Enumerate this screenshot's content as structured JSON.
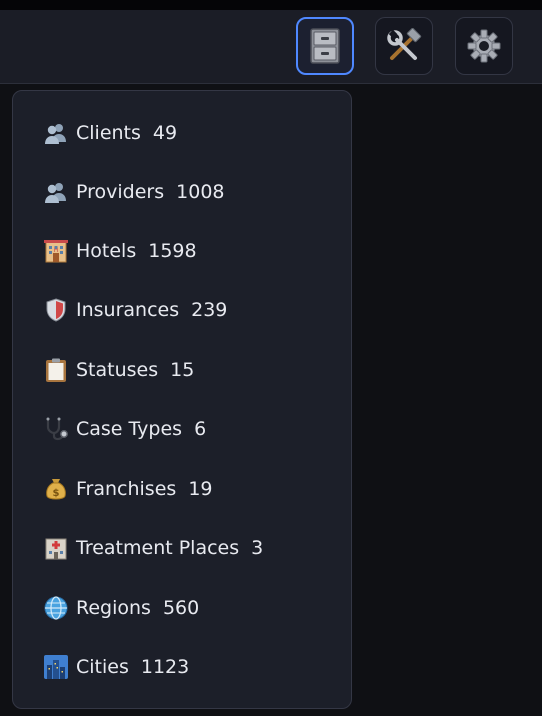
{
  "header": {
    "buttons": [
      {
        "name": "database-button",
        "icon": "filing-cabinet-icon",
        "active": true
      },
      {
        "name": "tools-button",
        "icon": "hammer-and-wrench-icon",
        "active": false
      },
      {
        "name": "settings-button",
        "icon": "gear-icon",
        "active": false
      }
    ]
  },
  "menu": {
    "items": [
      {
        "icon": "people-icon",
        "label": "Clients",
        "count": "49"
      },
      {
        "icon": "people-icon",
        "label": "Providers",
        "count": "1008"
      },
      {
        "icon": "hotel-icon",
        "label": "Hotels",
        "count": "1598"
      },
      {
        "icon": "shield-icon",
        "label": "Insurances",
        "count": "239"
      },
      {
        "icon": "clipboard-icon",
        "label": "Statuses",
        "count": "15"
      },
      {
        "icon": "stethoscope-icon",
        "label": "Case Types",
        "count": "6"
      },
      {
        "icon": "money-bag-icon",
        "label": "Franchises",
        "count": "19"
      },
      {
        "icon": "hospital-icon",
        "label": "Treatment Places",
        "count": "3"
      },
      {
        "icon": "globe-icon",
        "label": "Regions",
        "count": "560"
      },
      {
        "icon": "cityscape-icon",
        "label": "Cities",
        "count": "1123"
      }
    ]
  },
  "colors": {
    "accent": "#4f88ff",
    "panel": "#1c1f29",
    "header": "#1b1d26",
    "background": "#0f1014"
  }
}
